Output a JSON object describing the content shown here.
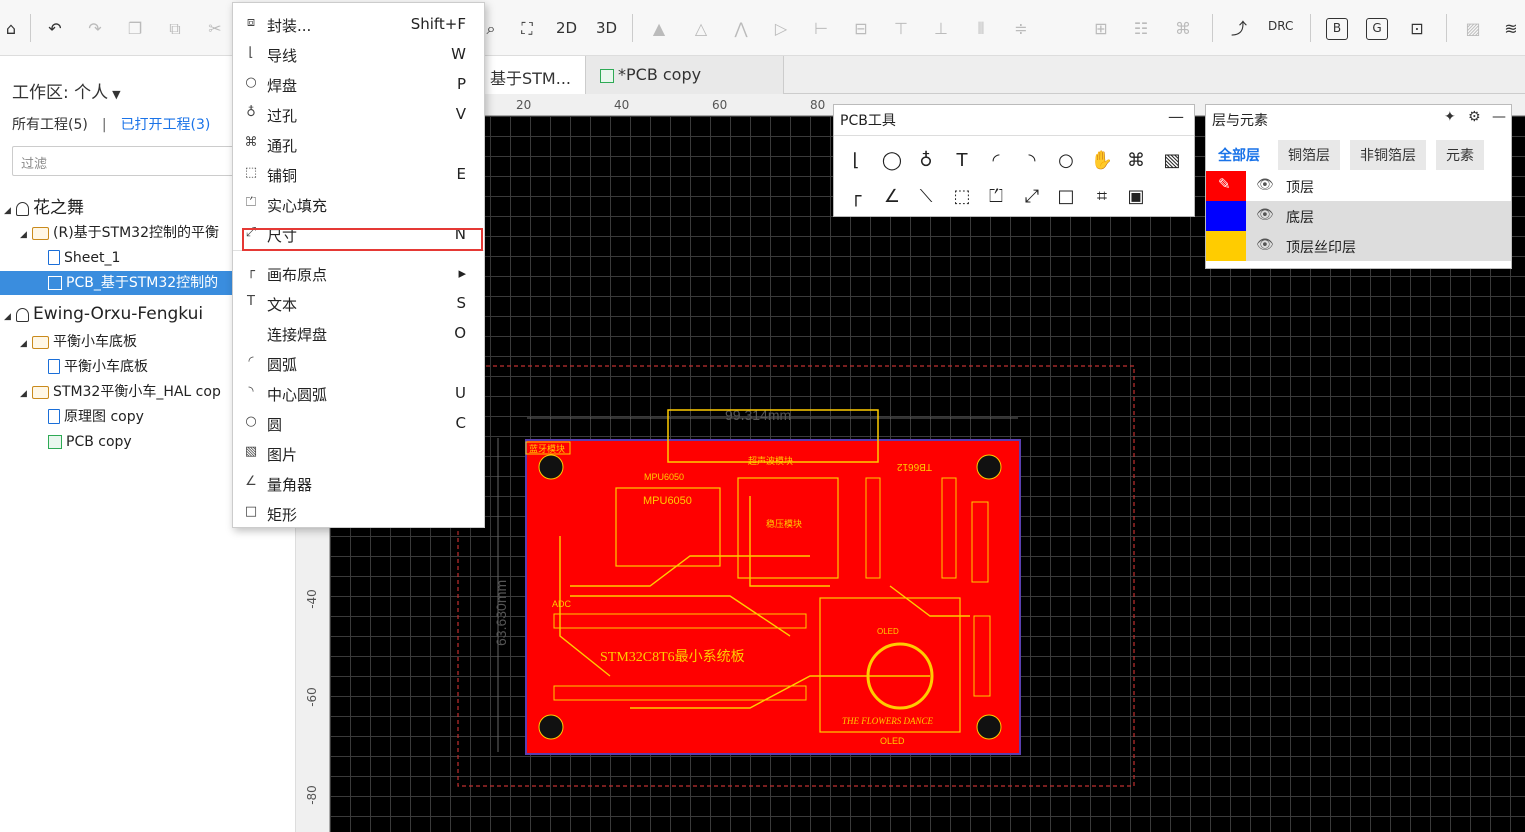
{
  "toolbar": {
    "icons": [
      "undo-icon",
      "redo-icon",
      "copy-icon",
      "duplicate-icon",
      "cut-icon",
      "zoom-icon",
      "fit-icon"
    ],
    "btn_2d": "2D",
    "btn_3d": "3D",
    "btn_drc": "DRC",
    "btn_b": "B",
    "btn_g": "G"
  },
  "sidebar": {
    "workspace_label": "工作区: 个人",
    "all_projects": "所有工程(5)",
    "divider": "|",
    "opened_projects": "已打开工程(3)",
    "filter_placeholder": "过滤",
    "tree": [
      {
        "label": "花之舞",
        "type": "user",
        "level": 0
      },
      {
        "label": "(R)基于STM32控制的平衡",
        "type": "project",
        "level": 1
      },
      {
        "label": "Sheet_1",
        "type": "sheet",
        "level": 2
      },
      {
        "label": "PCB_基于STM32控制的",
        "type": "pcb",
        "level": 2,
        "selected": true
      },
      {
        "label": "Ewing-Orxu-Fengkui",
        "type": "user",
        "level": 0
      },
      {
        "label": "平衡小车底板",
        "type": "folder",
        "level": 1
      },
      {
        "label": "平衡小车底板",
        "type": "sheet",
        "level": 2
      },
      {
        "label": "STM32平衡小车_HAL cop",
        "type": "folder",
        "level": 1
      },
      {
        "label": "原理图 copy",
        "type": "sheet",
        "level": 2
      },
      {
        "label": "PCB copy",
        "type": "pcb",
        "level": 2
      }
    ]
  },
  "doc_tabs": [
    {
      "label": "基于STM..."
    },
    {
      "label": "*PCB copy"
    }
  ],
  "ruler": {
    "top_ticks": [
      "20",
      "40",
      "60",
      "80"
    ],
    "left_ticks": [
      "-40",
      "-60",
      "-80"
    ]
  },
  "context_menu": {
    "items": [
      {
        "label": "封装...",
        "key": "Shift+F",
        "icon": "footprint-icon"
      },
      {
        "label": "导线",
        "key": "W",
        "icon": "track-icon"
      },
      {
        "label": "焊盘",
        "key": "P",
        "icon": "pad-icon"
      },
      {
        "label": "过孔",
        "key": "V",
        "icon": "via-icon"
      },
      {
        "label": "通孔",
        "key": "",
        "icon": "hole-icon"
      },
      {
        "label": "铺铜",
        "key": "E",
        "icon": "copper-area-icon"
      },
      {
        "label": "实心填充",
        "key": "",
        "icon": "solid-fill-icon"
      },
      {
        "label": "尺寸",
        "key": "N",
        "icon": "dimension-icon"
      },
      {
        "label": "画布原点",
        "key": "▸",
        "icon": "canvas-origin-icon"
      },
      {
        "label": "文本",
        "key": "S",
        "icon": "text-icon"
      },
      {
        "label": "连接焊盘",
        "key": "O",
        "icon": "connect-pad-icon"
      },
      {
        "label": "圆弧",
        "key": "",
        "icon": "arc-icon"
      },
      {
        "label": "中心圆弧",
        "key": "U",
        "icon": "center-arc-icon"
      },
      {
        "label": "圆",
        "key": "C",
        "icon": "circle-icon"
      },
      {
        "label": "图片",
        "key": "",
        "icon": "image-icon"
      },
      {
        "label": "量角器",
        "key": "",
        "icon": "protractor-icon"
      },
      {
        "label": "矩形",
        "key": "",
        "icon": "rectangle-icon"
      }
    ]
  },
  "pcb_tools": {
    "title": "PCB工具",
    "minimize": "—"
  },
  "layers": {
    "title": "层与元素",
    "tabs": [
      "全部层",
      "铜箔层",
      "非铜箔层",
      "元素"
    ],
    "rows": [
      {
        "name": "顶层",
        "color": "#ff0000"
      },
      {
        "name": "底层",
        "color": "#0000ff"
      },
      {
        "name": "顶层丝印层",
        "color": "#ffcc00"
      }
    ]
  },
  "board": {
    "dim_width": "99.314mm",
    "dim_height": "63.630mm",
    "main_label": "STM32C8T6最小系统板",
    "label_bluetooth": "蓝牙模块",
    "label_ultrasonic": "超声波模块",
    "label_regulator": "稳压模块",
    "label_mpu_top": "MPU6050",
    "label_mpu": "MPU6050",
    "label_tb": "TB6612",
    "label_adc": "ADC",
    "label_oled": "OLED",
    "label_oled2": "OLED",
    "label_logo": "THE FLOWERS DANCE",
    "colors": {
      "board": "#ff0000",
      "silk": "#ffcc00"
    }
  }
}
